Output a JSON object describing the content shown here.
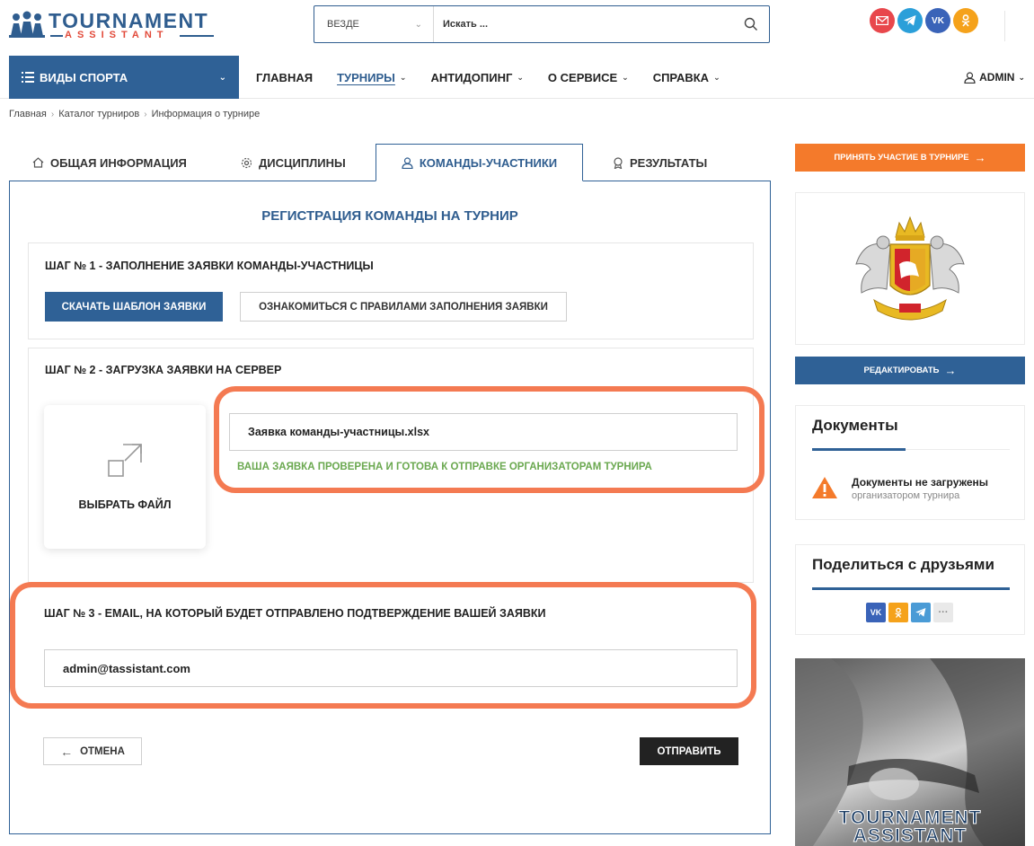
{
  "header": {
    "logo_top": "TOURNAMENT",
    "logo_bottom": "ASSISTANT",
    "search": {
      "scope": "ВЕЗДЕ",
      "placeholder": "Искать ..."
    },
    "social": [
      {
        "name": "mail",
        "color": "#e8474c"
      },
      {
        "name": "telegram",
        "color": "#2b9fd9"
      },
      {
        "name": "vk",
        "color": "#3a63b8"
      },
      {
        "name": "odnoklassniki",
        "color": "#f5a21b"
      }
    ]
  },
  "nav": {
    "sports_label": "ВИДЫ СПОРТА",
    "items": [
      {
        "label": "ГЛАВНАЯ",
        "dropdown": false,
        "active": false
      },
      {
        "label": "ТУРНИРЫ",
        "dropdown": true,
        "active": true
      },
      {
        "label": "АНТИДОПИНГ",
        "dropdown": true,
        "active": false
      },
      {
        "label": "О СЕРВИСЕ",
        "dropdown": true,
        "active": false
      },
      {
        "label": "СПРАВКА",
        "dropdown": true,
        "active": false
      }
    ],
    "user": "ADMIN"
  },
  "breadcrumb": [
    "Главная",
    "Каталог турниров",
    "Информация о турнире"
  ],
  "tabs": [
    {
      "label": "ОБЩАЯ ИНФОРМАЦИЯ",
      "icon": "home-icon"
    },
    {
      "label": "ДИСЦИПЛИНЫ",
      "icon": "gear-icon"
    },
    {
      "label": "КОМАНДЫ-УЧАСТНИКИ",
      "icon": "user-icon"
    },
    {
      "label": "РЕЗУЛЬТАТЫ",
      "icon": "award-icon"
    }
  ],
  "registration": {
    "title": "РЕГИСТРАЦИЯ КОМАНДЫ НА ТУРНИР",
    "step1": {
      "title": "ШАГ № 1 - ЗАПОЛНЕНИЕ ЗАЯВКИ КОМАНДЫ-УЧАСТНИЦЫ",
      "download_label": "СКАЧАТЬ ШАБЛОН ЗАЯВКИ",
      "rules_label": "ОЗНАКОМИТЬСЯ С ПРАВИЛАМИ ЗАПОЛНЕНИЯ ЗАЯВКИ"
    },
    "step2": {
      "title": "ШАГ № 2 - ЗАГРУЗКА ЗАЯВКИ НА СЕРВЕР",
      "choose_file_label": "ВЫБРАТЬ ФАЙЛ",
      "file_name": "Заявка команды-участницы.xlsx",
      "status": "ВАША ЗАЯВКА ПРОВЕРЕНА И ГОТОВА К ОТПРАВКЕ ОРГАНИЗАТОРАМ ТУРНИРА"
    },
    "step3": {
      "title": "ШАГ № 3 - EMAIL, НА КОТОРЫЙ БУДЕТ ОТПРАВЛЕНО ПОДТВЕРЖДЕНИЕ ВАШЕЙ ЗАЯВКИ",
      "email": "admin@tassistant.com"
    },
    "cancel_label": "ОТМЕНА",
    "submit_label": "ОТПРАВИТЬ"
  },
  "sidebar": {
    "join_label": "ПРИНЯТЬ УЧАСТИЕ В ТУРНИРЕ",
    "edit_label": "РЕДАКТИРОВАТЬ",
    "documents": {
      "title": "Документы",
      "line1": "Документы не загружены",
      "line2": "организатором турнира"
    },
    "share": {
      "title": "Поделиться с друзьями",
      "buttons": [
        {
          "name": "vk",
          "color": "#3a63b8"
        },
        {
          "name": "odnoklassniki",
          "color": "#f5a21b"
        },
        {
          "name": "telegram",
          "color": "#4a9bd6"
        },
        {
          "name": "more",
          "color": "#e9e9e9"
        }
      ]
    },
    "promo_line1": "TOURNAMENT",
    "promo_line2": "ASSISTANT"
  },
  "colors": {
    "brand_blue": "#2f6196",
    "accent_orange": "#f47a2b",
    "highlight": "#f47a52",
    "success_green": "#6aa84f"
  }
}
